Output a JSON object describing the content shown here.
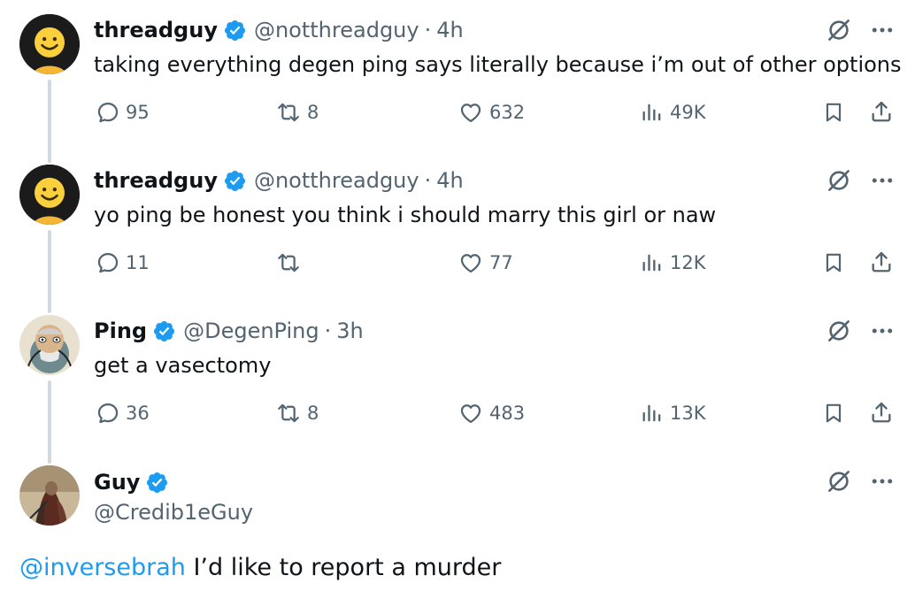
{
  "tweets": [
    {
      "name": "threadguy",
      "handle": "@notthreadguy",
      "time": "4h",
      "text": "taking everything degen ping says literally because i’m out of other options",
      "replies": "95",
      "reposts": "8",
      "likes": "632",
      "views": "49K"
    },
    {
      "name": "threadguy",
      "handle": "@notthreadguy",
      "time": "4h",
      "text": "yo ping be honest you think i should marry this girl or naw",
      "replies": "11",
      "reposts": "",
      "likes": "77",
      "views": "12K"
    },
    {
      "name": "Ping",
      "handle": "@DegenPing",
      "time": "3h",
      "text": "get a vasectomy",
      "replies": "36",
      "reposts": "8",
      "likes": "483",
      "views": "13K"
    }
  ],
  "main_tweet": {
    "name": "Guy",
    "handle": "@Credib1eGuy",
    "mention": "@inversebrah",
    "text": " I’d like to report a murder"
  },
  "icons": {
    "reply": "reply-icon",
    "repost": "repost-icon",
    "like": "heart-icon",
    "views": "views-icon",
    "bookmark": "bookmark-icon",
    "share": "share-icon",
    "grok": "grok-icon",
    "more": "more-icon",
    "verified": "verified-badge-icon"
  },
  "colors": {
    "text": "#0f1419",
    "secondary": "#536471",
    "accent": "#1d9bf0",
    "thread_line": "#cfd9de"
  }
}
